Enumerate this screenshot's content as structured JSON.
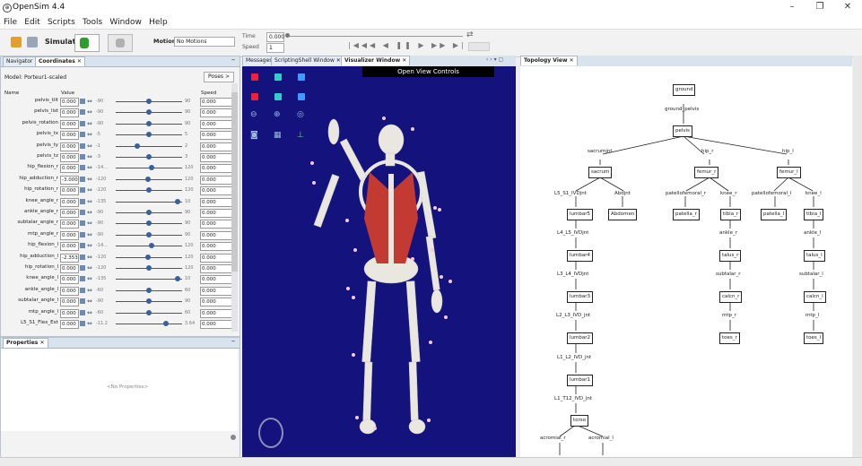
{
  "app": {
    "title": "OpenSim 4.4"
  },
  "menu": [
    "File",
    "Edit",
    "Scripts",
    "Tools",
    "Window",
    "Help"
  ],
  "toolbar": {
    "simulate_label": "Simulate",
    "motion_label": "Motion:",
    "motion_value": "No Motions",
    "time_label": "Time",
    "time_value": "0.000",
    "speed_label": "Speed",
    "speed_value": "1"
  },
  "navigator": {
    "tab_navigator": "Navigator",
    "tab_coordinates": "Coordinates",
    "model_label": "Model: Porteur1-scaled",
    "poses_button": "Poses >",
    "col_name": "Name",
    "col_value": "Value",
    "col_speed": "Speed",
    "rows": [
      {
        "name": "pelvis_tilt",
        "value": "0.000",
        "min": "-90",
        "max": "90",
        "speed": "0.000",
        "pos": 0.5
      },
      {
        "name": "pelvis_list",
        "value": "0.000",
        "min": "-90",
        "max": "90",
        "speed": "0.000",
        "pos": 0.5
      },
      {
        "name": "pelvis_rotation",
        "value": "0.000",
        "min": "-90",
        "max": "90",
        "speed": "0.000",
        "pos": 0.5
      },
      {
        "name": "pelvis_tx",
        "value": "0.000",
        "min": "-5",
        "max": "5",
        "speed": "0.000",
        "pos": 0.5
      },
      {
        "name": "pelvis_ty",
        "value": "0.000",
        "min": "-1",
        "max": "2",
        "speed": "0.000",
        "pos": 0.33
      },
      {
        "name": "pelvis_tz",
        "value": "0.000",
        "min": "-3",
        "max": "3",
        "speed": "0.000",
        "pos": 0.5
      },
      {
        "name": "hip_flexion_r",
        "value": "0.000",
        "min": "-14...",
        "max": "120",
        "speed": "0.000",
        "pos": 0.54
      },
      {
        "name": "hip_adduction_r",
        "value": "-3.000",
        "min": "-120",
        "max": "120",
        "speed": "0.000",
        "pos": 0.49
      },
      {
        "name": "hip_rotation_r",
        "value": "0.000",
        "min": "-120",
        "max": "120",
        "speed": "0.000",
        "pos": 0.5
      },
      {
        "name": "knee_angle_r",
        "value": "0.000",
        "min": "-135",
        "max": "10",
        "speed": "0.000",
        "pos": 0.93
      },
      {
        "name": "ankle_angle_r",
        "value": "0.000",
        "min": "-90",
        "max": "90",
        "speed": "0.000",
        "pos": 0.5
      },
      {
        "name": "subtalar_angle_r",
        "value": "0.000",
        "min": "-90",
        "max": "90",
        "speed": "0.000",
        "pos": 0.5
      },
      {
        "name": "mtp_angle_r",
        "value": "0.000",
        "min": "-90",
        "max": "90",
        "speed": "0.000",
        "pos": 0.5
      },
      {
        "name": "hip_flexion_l",
        "value": "0.000",
        "min": "-14...",
        "max": "120",
        "speed": "0.000",
        "pos": 0.54
      },
      {
        "name": "hip_adduction_l",
        "value": "-2.353",
        "min": "-120",
        "max": "120",
        "speed": "0.000",
        "pos": 0.49
      },
      {
        "name": "hip_rotation_l",
        "value": "0.000",
        "min": "-120",
        "max": "120",
        "speed": "0.000",
        "pos": 0.5
      },
      {
        "name": "knee_angle_l",
        "value": "0.000",
        "min": "-135",
        "max": "10",
        "speed": "0.000",
        "pos": 0.93
      },
      {
        "name": "ankle_angle_l",
        "value": "0.000",
        "min": "-60",
        "max": "60",
        "speed": "0.000",
        "pos": 0.5
      },
      {
        "name": "subtalar_angle_l",
        "value": "0.000",
        "min": "-90",
        "max": "90",
        "speed": "0.000",
        "pos": 0.5
      },
      {
        "name": "mtp_angle_l",
        "value": "0.000",
        "min": "-60",
        "max": "60",
        "speed": "0.000",
        "pos": 0.5
      },
      {
        "name": "L5_S1_Flex_Ext",
        "value": "0.000",
        "min": "-11.2",
        "max": "3.64",
        "speed": "0.000",
        "pos": 0.75
      }
    ]
  },
  "properties": {
    "tab": "Properties",
    "empty_text": "<No Properties>"
  },
  "center_tabs": {
    "messages": "Messages",
    "scripting": "ScriptingShell Window",
    "visualizer": "Visualizer Window"
  },
  "visualizer": {
    "open_view_controls": "Open View Controls"
  },
  "topology": {
    "tab": "Topology View",
    "nodes": {
      "ground": "ground",
      "ground_pelvis": "ground_pelvis",
      "pelvis": "pelvis",
      "sacrumjnt": "sacrumjnt",
      "hip_r": "hip_r",
      "hip_l": "hip_l",
      "sacrum": "sacrum",
      "femur_r": "femur_r",
      "femur_l": "femur_l",
      "l5s1": "L5_S1_IVDjnt",
      "abdjnt": "Abdjnt",
      "patfem_r": "patellofemoral_r",
      "knee_r": "knee_r",
      "patfem_l": "patellofemoral_l",
      "knee_l": "knee_l",
      "lumbar5": "lumbar5",
      "abdomen": "Abdomen",
      "patella_r": "patella_r",
      "tibia_r": "tibia_r",
      "patella_l": "patella_l",
      "tibia_l": "tibia_l",
      "l4l5": "L4_L5_IVDjnt",
      "ankle_r": "ankle_r",
      "ankle_l": "ankle_l",
      "lumbar4": "lumbar4",
      "talus_r": "talus_r",
      "talus_l": "talus_l",
      "l3l4": "L3_L4_IVDjnt",
      "subtalar_r": "subtalar_r",
      "subtalar_l": "subtalar_l",
      "lumbar3": "lumbar3",
      "calcn_r": "calcn_r",
      "calcn_l": "calcn_l",
      "l2l3": "L2_L3_IVD_jnt",
      "mtp_r": "mtp_r",
      "mtp_l": "mtp_l",
      "lumbar2": "lumbar2",
      "toes_r": "toes_r",
      "toes_l": "toes_l",
      "l1l2": "L1_L2_IVD_jnt",
      "lumbar1": "lumbar1",
      "l1t12": "L1_T12_IVD_jnt",
      "torso": "torso",
      "acromial_r": "acromial_r",
      "acromial_l": "acromial_l"
    }
  }
}
